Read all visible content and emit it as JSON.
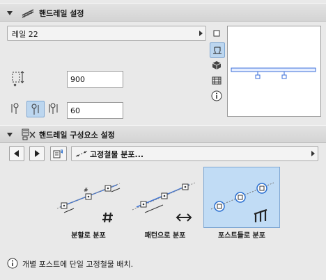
{
  "section1": {
    "title": "핸드레일 설정",
    "icon": "handrail-icon"
  },
  "rail_select": {
    "value": "레일 22"
  },
  "height_field": {
    "value": "900"
  },
  "offset_field": {
    "value": "60"
  },
  "side_views": [
    "plan-icon",
    "section-icon",
    "3d-icon",
    "elevation-icon",
    "info-icon"
  ],
  "section2": {
    "title": "핸드레일 구성요소 설정",
    "icon": "components-icon"
  },
  "component_select": {
    "value": "고정철물 분포..."
  },
  "distribution": [
    {
      "label": "분할로 분포",
      "icon": "hash-icon"
    },
    {
      "label": "패턴으로 분포",
      "icon": "left-right-arrow-icon"
    },
    {
      "label": "포스트들로 분포",
      "icon": "posts-icon",
      "selected": true
    }
  ],
  "info": {
    "text": "개별 포스트에 단일 고정철물 배치."
  },
  "colors": {
    "accent": "#4f8fd6",
    "selected_bg": "#c1dcf5",
    "selected_border": "#7ea7d3"
  }
}
